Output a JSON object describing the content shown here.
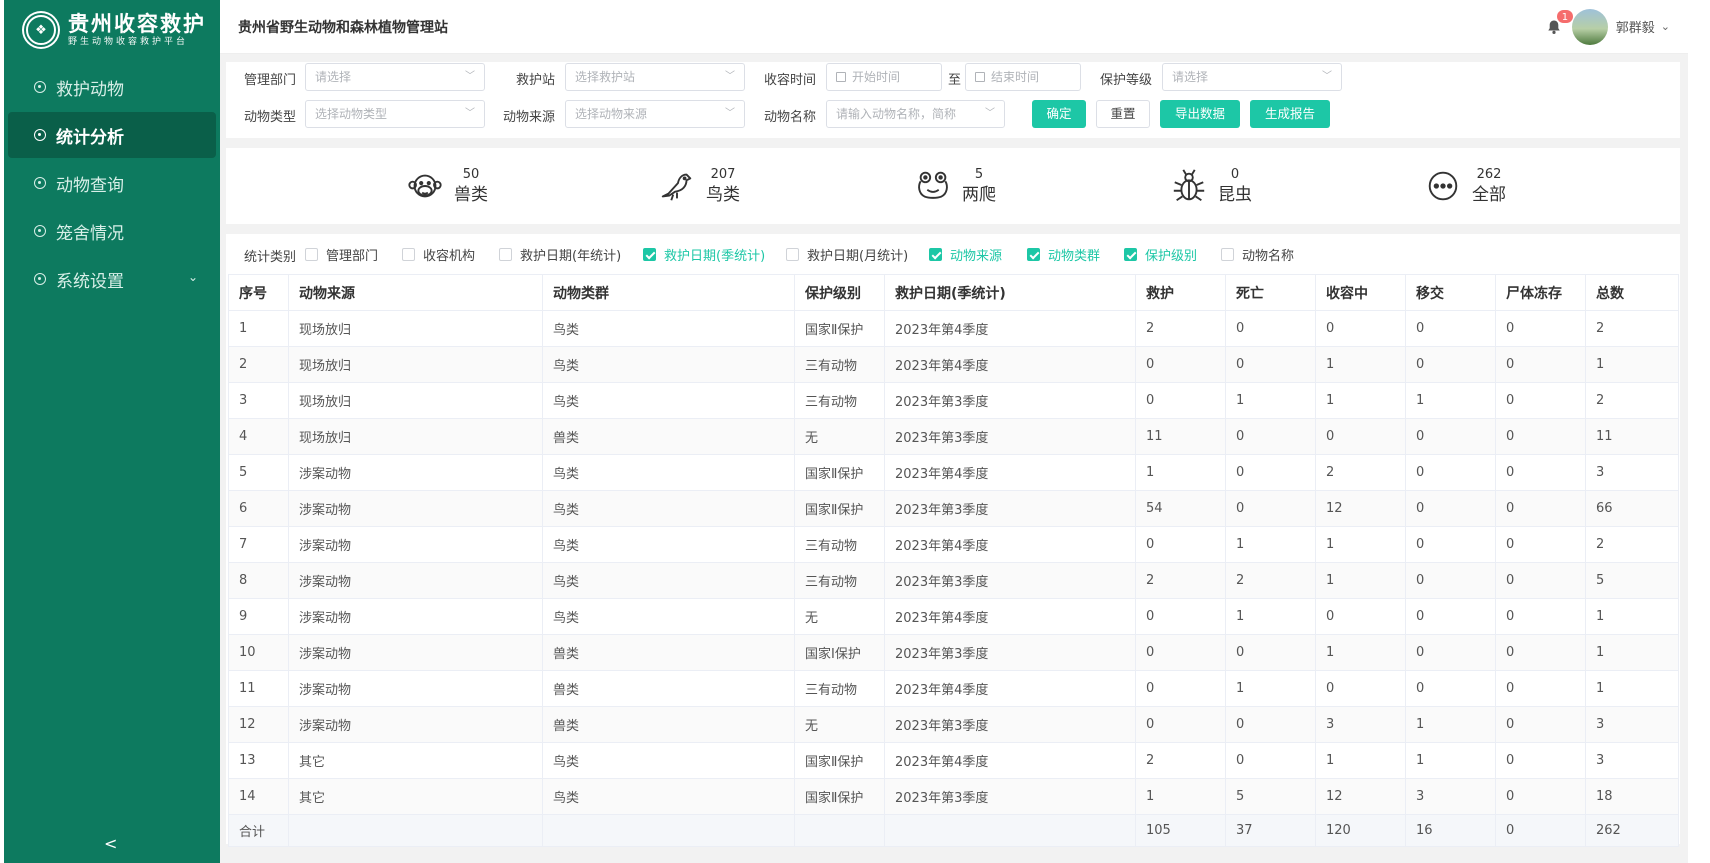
{
  "sidebar": {
    "brand_title": "贵州收容救护",
    "brand_subtitle": "野生动物收容救护平台",
    "items": [
      {
        "label": "救护动物",
        "active": false
      },
      {
        "label": "统计分析",
        "active": true
      },
      {
        "label": "动物查询",
        "active": false
      },
      {
        "label": "笼舍情况",
        "active": false
      },
      {
        "label": "系统设置",
        "active": false
      }
    ],
    "collapse_glyph": "<"
  },
  "header": {
    "title": "贵州省野生动物和森林植物管理站",
    "notification_count": "1",
    "user_name": "郭群毅"
  },
  "filters": {
    "dept_label": "管理部门",
    "dept_placeholder": "请选择",
    "station_label": "救护站",
    "station_placeholder": "选择救护站",
    "time_label": "收容时间",
    "start_placeholder": "开始时间",
    "to": "至",
    "end_placeholder": "结束时间",
    "level_label": "保护等级",
    "level_placeholder": "请选择",
    "type_label": "动物类型",
    "type_placeholder": "选择动物类型",
    "source_label": "动物来源",
    "source_placeholder": "选择动物来源",
    "name_label": "动物名称",
    "name_placeholder": "请输入动物名称，简称",
    "confirm": "确定",
    "reset": "重置",
    "export": "导出数据",
    "report": "生成报告"
  },
  "stats": [
    {
      "count": "50",
      "label": "兽类",
      "icon": "monkey-icon"
    },
    {
      "count": "207",
      "label": "鸟类",
      "icon": "bird-icon"
    },
    {
      "count": "5",
      "label": "两爬",
      "icon": "frog-icon"
    },
    {
      "count": "0",
      "label": "昆虫",
      "icon": "bug-icon"
    },
    {
      "count": "262",
      "label": "全部",
      "icon": "more-icon"
    }
  ],
  "categories": {
    "title": "统计类别",
    "items": [
      {
        "label": "管理部门",
        "checked": false
      },
      {
        "label": "收容机构",
        "checked": false
      },
      {
        "label": "救护日期(年统计)",
        "checked": false
      },
      {
        "label": "救护日期(季统计)",
        "checked": true
      },
      {
        "label": "救护日期(月统计)",
        "checked": false
      },
      {
        "label": "动物来源",
        "checked": true
      },
      {
        "label": "动物类群",
        "checked": true
      },
      {
        "label": "保护级别",
        "checked": true
      },
      {
        "label": "动物名称",
        "checked": false
      }
    ]
  },
  "table": {
    "headers": [
      "序号",
      "动物来源",
      "动物类群",
      "保护级别",
      "救护日期(季统计)",
      "救护",
      "死亡",
      "收容中",
      "移交",
      "尸体冻存",
      "总数"
    ],
    "rows": [
      [
        "1",
        "现场放归",
        "鸟类",
        "国家Ⅱ保护",
        "2023年第4季度",
        "2",
        "0",
        "0",
        "0",
        "0",
        "2"
      ],
      [
        "2",
        "现场放归",
        "鸟类",
        "三有动物",
        "2023年第4季度",
        "0",
        "0",
        "1",
        "0",
        "0",
        "1"
      ],
      [
        "3",
        "现场放归",
        "鸟类",
        "三有动物",
        "2023年第3季度",
        "0",
        "1",
        "1",
        "1",
        "0",
        "2"
      ],
      [
        "4",
        "现场放归",
        "兽类",
        "无",
        "2023年第3季度",
        "11",
        "0",
        "0",
        "0",
        "0",
        "11"
      ],
      [
        "5",
        "涉案动物",
        "鸟类",
        "国家Ⅱ保护",
        "2023年第4季度",
        "1",
        "0",
        "2",
        "0",
        "0",
        "3"
      ],
      [
        "6",
        "涉案动物",
        "鸟类",
        "国家Ⅱ保护",
        "2023年第3季度",
        "54",
        "0",
        "12",
        "0",
        "0",
        "66"
      ],
      [
        "7",
        "涉案动物",
        "鸟类",
        "三有动物",
        "2023年第4季度",
        "0",
        "1",
        "1",
        "0",
        "0",
        "2"
      ],
      [
        "8",
        "涉案动物",
        "鸟类",
        "三有动物",
        "2023年第3季度",
        "2",
        "2",
        "1",
        "0",
        "0",
        "5"
      ],
      [
        "9",
        "涉案动物",
        "鸟类",
        "无",
        "2023年第4季度",
        "0",
        "1",
        "0",
        "0",
        "0",
        "1"
      ],
      [
        "10",
        "涉案动物",
        "兽类",
        "国家Ⅰ保护",
        "2023年第3季度",
        "0",
        "0",
        "1",
        "0",
        "0",
        "1"
      ],
      [
        "11",
        "涉案动物",
        "兽类",
        "三有动物",
        "2023年第4季度",
        "0",
        "1",
        "0",
        "0",
        "0",
        "1"
      ],
      [
        "12",
        "涉案动物",
        "兽类",
        "无",
        "2023年第3季度",
        "0",
        "0",
        "3",
        "1",
        "0",
        "3"
      ],
      [
        "13",
        "其它",
        "鸟类",
        "国家Ⅱ保护",
        "2023年第4季度",
        "2",
        "0",
        "1",
        "1",
        "0",
        "3"
      ],
      [
        "14",
        "其它",
        "鸟类",
        "国家Ⅱ保护",
        "2023年第3季度",
        "1",
        "5",
        "12",
        "3",
        "0",
        "18"
      ]
    ],
    "footer": [
      "合计",
      "",
      "",
      "",
      "",
      "105",
      "37",
      "120",
      "16",
      "0",
      "262"
    ]
  },
  "colors": {
    "sidebar": "#0d7a5f",
    "accent": "#1dc7a6",
    "badge": "#f56c6c"
  }
}
